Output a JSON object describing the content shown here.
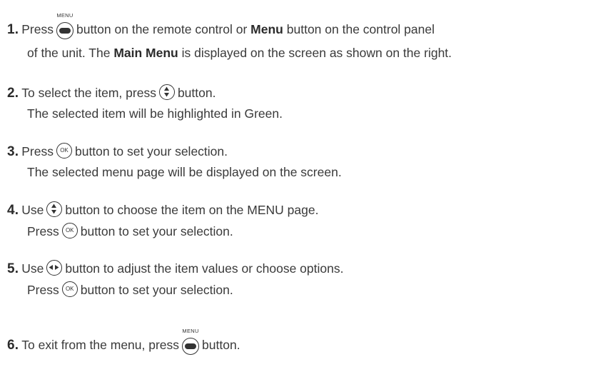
{
  "steps": [
    {
      "number": "1.",
      "line1": {
        "pre": "Press",
        "icon": "menu-button-icon",
        "icon_caption": "MENU",
        "mid": "button on the remote control or",
        "bold": "Menu",
        "post": "button on the control panel"
      },
      "line2": {
        "pre": "of the unit. The",
        "bold": "Main Menu",
        "post": "is displayed on the screen as shown on the right."
      }
    },
    {
      "number": "2.",
      "line1": {
        "pre": "To select the item, press",
        "icon": "up-down-button-icon",
        "post": "button."
      },
      "line2": "The selected item will be highlighted in Green."
    },
    {
      "number": "3.",
      "line1": {
        "pre": "Press",
        "icon": "ok-button-icon",
        "icon_label": "OK",
        "post": "button to set your selection."
      },
      "line2": "The selected menu page will be displayed on the screen."
    },
    {
      "number": "4.",
      "line1": {
        "pre": "Use",
        "icon": "up-down-button-icon",
        "post": "button to choose the item on the MENU page."
      },
      "line2": {
        "pre": "Press",
        "icon": "ok-button-icon",
        "icon_label": "OK",
        "post": "button to set your selection."
      }
    },
    {
      "number": "5.",
      "line1": {
        "pre": "Use",
        "icon": "left-right-button-icon",
        "post": "button to adjust the item values or choose options."
      },
      "line2": {
        "pre": "Press",
        "icon": "ok-button-icon",
        "icon_label": "OK",
        "post": "button to set your selection."
      }
    },
    {
      "number": "6.",
      "line1": {
        "pre": "To exit from the menu, press",
        "icon": "menu-button-icon",
        "icon_caption": "MENU",
        "post": "button."
      }
    }
  ]
}
